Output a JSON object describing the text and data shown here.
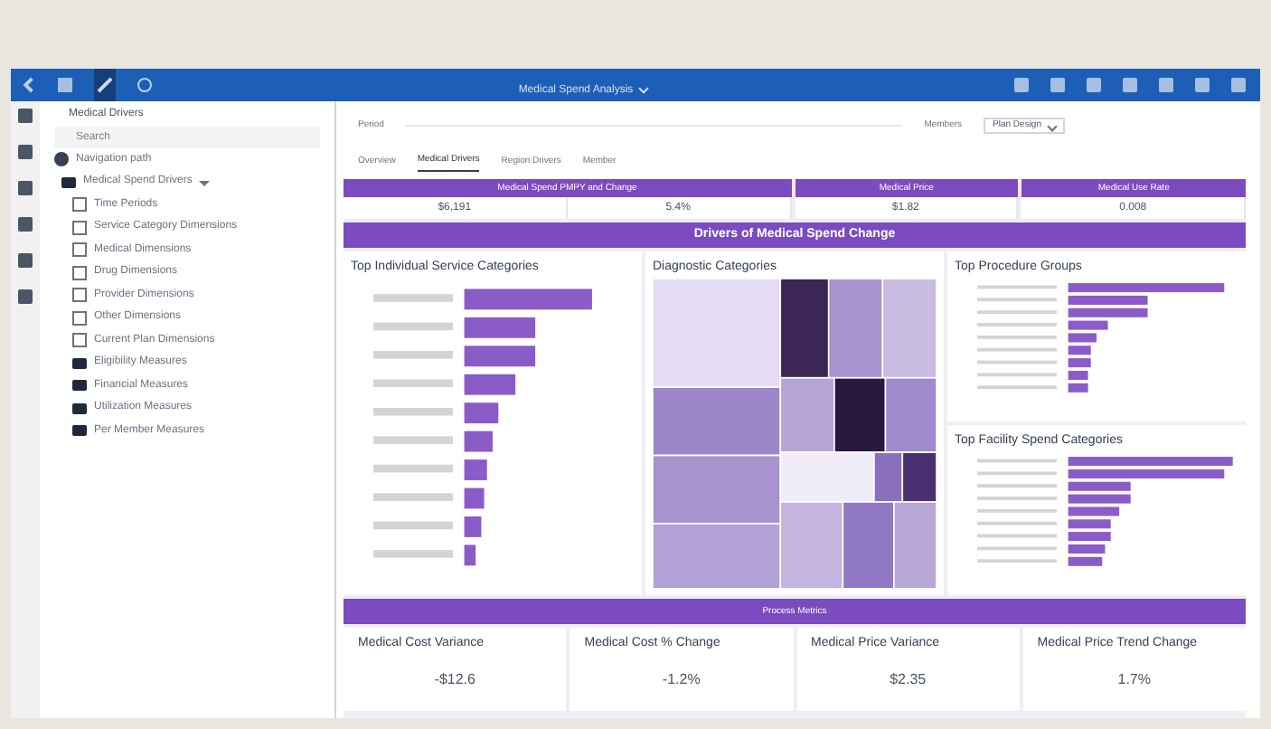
{
  "toolbar": {
    "title": "Medical Spend Analysis"
  },
  "tree": {
    "title": "Medical Drivers",
    "search": {
      "placeholder": "Search"
    },
    "items": [
      {
        "label": "Navigation path",
        "kind": "item"
      },
      {
        "label": "Medical Spend Drivers",
        "kind": "folder",
        "expanded": true,
        "children": [
          {
            "label": "Time Periods",
            "kind": "table"
          },
          {
            "label": "Service Category Dimensions",
            "kind": "table"
          },
          {
            "label": "Medical Dimensions",
            "kind": "table"
          },
          {
            "label": "Drug Dimensions",
            "kind": "table"
          },
          {
            "label": "Provider Dimensions",
            "kind": "table"
          },
          {
            "label": "Other Dimensions",
            "kind": "table"
          },
          {
            "label": "Current Plan Dimensions",
            "kind": "table"
          },
          {
            "label": "Eligibility Measures",
            "kind": "folder"
          },
          {
            "label": "Financial Measures",
            "kind": "folder"
          },
          {
            "label": "Utilization Measures",
            "kind": "folder"
          },
          {
            "label": "Per Member Measures",
            "kind": "folder"
          }
        ]
      }
    ]
  },
  "filters": {
    "date_label": "Period",
    "member_label": "Members",
    "dropdown": "Plan Design"
  },
  "tabs": [
    {
      "label": "Overview",
      "selected": false
    },
    {
      "label": "Medical Drivers",
      "selected": true
    },
    {
      "label": "Region Drivers",
      "selected": false
    },
    {
      "label": "Member",
      "selected": false
    }
  ],
  "summary": [
    {
      "title": "Medical Spend PMPY and Change",
      "values": [
        "$6,191",
        "5.4%"
      ]
    },
    {
      "title": "Medical Price",
      "values": [
        "$1.82"
      ]
    },
    {
      "title": "Medical Use Rate",
      "values": [
        "0.008"
      ]
    }
  ],
  "drivers": {
    "title": "Drivers of Medical Spend Change",
    "panels": [
      {
        "title": "Top Individual Service Categories",
        "kind": "bars"
      },
      {
        "title": "Diagnostic Categories",
        "kind": "treemap"
      },
      {
        "title": "Top Procedure Groups",
        "kind": "bars"
      },
      {
        "title": "Top Facility Spend Categories",
        "kind": "bars"
      }
    ]
  },
  "metrics": {
    "title": "Process Metrics",
    "cards": [
      {
        "title": "Medical Cost Variance",
        "value": "-$12.6"
      },
      {
        "title": "Medical Cost % Change",
        "value": "-1.2%"
      },
      {
        "title": "Medical Price Variance",
        "value": "$2.35"
      },
      {
        "title": "Medical Price Trend Change",
        "value": "1.7%"
      }
    ]
  }
}
